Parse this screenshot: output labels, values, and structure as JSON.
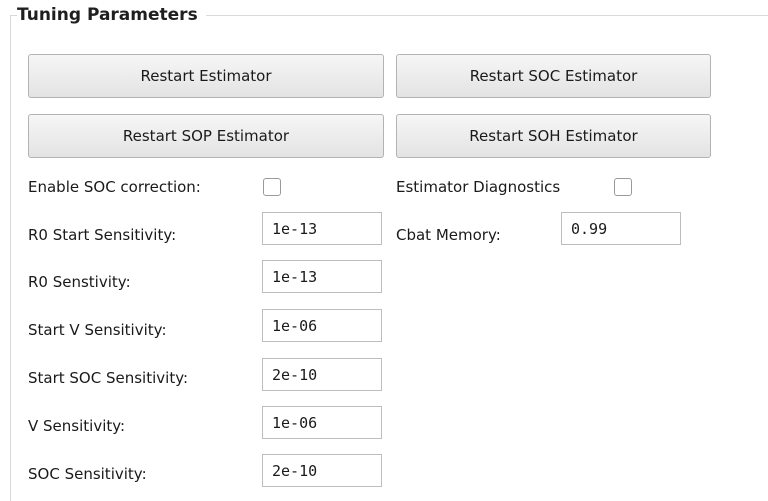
{
  "group": {
    "title": "Tuning Parameters"
  },
  "buttons": {
    "restart_estimator": "Restart Estimator",
    "restart_soc_estimator": "Restart SOC Estimator",
    "restart_sop_estimator": "Restart SOP Estimator",
    "restart_soh_estimator": "Restart SOH Estimator"
  },
  "checkboxes": {
    "enable_soc_correction": {
      "label": "Enable SOC correction:",
      "checked": false
    },
    "estimator_diagnostics": {
      "label": "Estimator Diagnostics",
      "checked": false
    }
  },
  "fields": {
    "r0_start_sensitivity": {
      "label": "R0 Start Sensitivity:",
      "value": "1e-13"
    },
    "r0_senstivity": {
      "label": "R0 Senstivity:",
      "value": "1e-13"
    },
    "start_v_sensitivity": {
      "label": "Start V Sensitivity:",
      "value": "1e-06"
    },
    "start_soc_sensitivity": {
      "label": "Start SOC Sensitivity:",
      "value": "2e-10"
    },
    "v_sensitivity": {
      "label": "V Sensitivity:",
      "value": "1e-06"
    },
    "soc_sensitivity": {
      "label": "SOC Sensitivity:",
      "value": "2e-10"
    },
    "cbat_memory": {
      "label": "Cbat Memory:",
      "value": "0.99"
    }
  }
}
